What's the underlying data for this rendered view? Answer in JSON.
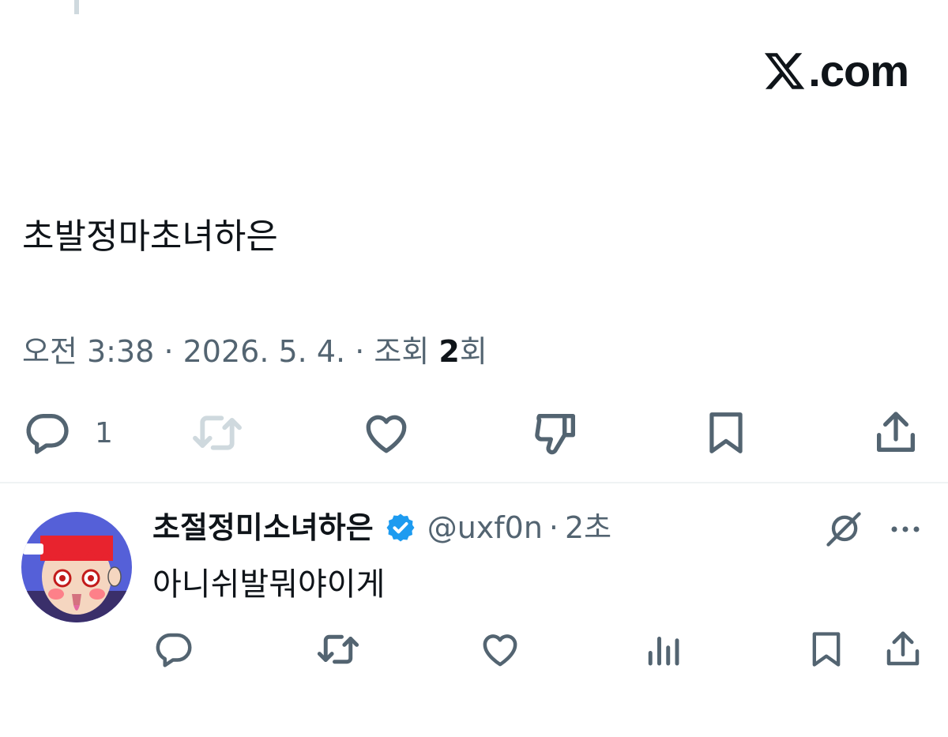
{
  "brand": {
    "domain_text": ".com",
    "logo_icon": "x-logo-icon"
  },
  "tweet": {
    "text": "초발정마초녀하은",
    "time": "오전 3:38",
    "separator": "·",
    "date": "2026. 5. 4.",
    "views_label_prefix": "조회",
    "views_count": "2",
    "views_label_suffix": "회",
    "actions": {
      "reply_icon": "comment-icon",
      "reply_count": "1",
      "retweet_icon": "retweet-icon",
      "like_icon": "heart-icon",
      "dislike_icon": "thumbs-down-icon",
      "bookmark_icon": "bookmark-icon",
      "share_icon": "share-icon"
    }
  },
  "reply": {
    "display_name": "초절정미소녀하은",
    "verified_icon": "verified-badge-icon",
    "handle": "@uxf0n",
    "separator": "·",
    "time": "2초",
    "text": "아니쉬발뭐야이게",
    "grok_icon": "grok-icon",
    "more_icon": "more-icon",
    "actions": {
      "reply_icon": "comment-icon",
      "retweet_icon": "retweet-icon",
      "like_icon": "heart-icon",
      "views_icon": "analytics-icon",
      "bookmark_icon": "bookmark-icon",
      "share_icon": "share-icon"
    }
  },
  "colors": {
    "text_primary": "#0f1419",
    "text_secondary": "#536471",
    "icon_disabled": "#cfd9de",
    "verified_blue": "#1d9bf0",
    "divider": "#eff3f4"
  }
}
